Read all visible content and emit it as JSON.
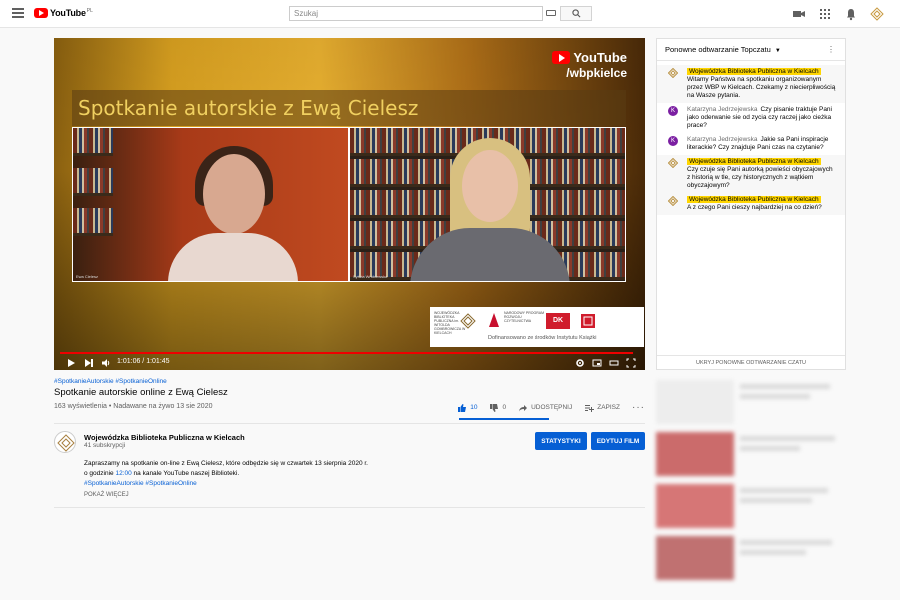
{
  "header": {
    "logo_text": "YouTube",
    "logo_region": "PL",
    "search_placeholder": "Szukaj"
  },
  "player": {
    "overlay_title": "Spotkanie autorskie z Ewą Cielesz",
    "brand_word": "YouTube",
    "brand_handle": "/wbpkielce",
    "cam_left_label": "Ewa Cielesz",
    "cam_right_label": "Sylwia Wróblewska",
    "sponsor_caption": "Dofinansowano ze środków Instytutu Książki",
    "sponsor_logo_1": "WOJEWÓDZKA BIBLIOTEKA PUBLICZNA im. WITOLDA GOMBROWICZA W KIELCACH",
    "sponsor_logo_2": "NARODOWY PROGRAM ROZWOJU CZYTELNICTWA",
    "sponsor_logo_3": "DK",
    "time_display": "1:01:06 / 1:01:45",
    "progress_fraction": 0.99
  },
  "video": {
    "hashtags": "#SpotkanieAutorskie #SpotkanieOnline",
    "title": "Spotkanie autorskie online z Ewą Cielesz",
    "stats": "163 wyświetlenia • Nadawane na żywo 13 sie 2020",
    "likes": "10",
    "dislikes": "0",
    "share_label": "UDOSTĘPNIJ",
    "save_label": "ZAPISZ"
  },
  "channel": {
    "name": "Wojewódzka Biblioteka Publiczna w Kielcach",
    "subs": "41 subskrypcji",
    "stats_button": "STATYSTYKI",
    "edit_button": "EDYTUJ FILM",
    "desc_line1": "Zapraszamy na spotkanie on-line z Ewą Cielesz, które odbędzie się w czwartek 13 sierpnia 2020 r.",
    "desc_line2_pre": "o godzinie ",
    "desc_line2_time": "12:00",
    "desc_line2_post": " na kanale YouTube naszej Biblioteki.",
    "desc_tags": "#SpotkanieAutorskie #SpotkanieOnline",
    "show_more": "POKAŻ WIĘCEJ"
  },
  "chat": {
    "title": "Ponowne odtwarzanie Topczatu",
    "hide_label": "UKRYJ PONOWNE ODTWARZANIE CZATU",
    "messages": [
      {
        "author": "Wojewódzka Biblioteka Publiczna w Kielcach",
        "text": "Witamy Państwa na spotkaniu organizowanym przez WBP w Kielcach. Czekamy z niecierpliwością na Wasze pytania."
      },
      {
        "author": "Katarzyna Jedrzejewska",
        "text": "Czy pisanie traktuje Pani jako oderwanie sie od zycia czy raczej jako cieżka prace?"
      },
      {
        "author": "Katarzyna Jedrzejewska",
        "text": "Jakie sa Pani inspiracje literackie? Czy znajduje Pani czas na czytanie?"
      },
      {
        "author": "Wojewódzka Biblioteka Publiczna w Kielcach",
        "text": "Czy czuje się Pani autorką powieści obyczajowych z historią w tle, czy historycznych z wątkiem obyczajowym?"
      },
      {
        "author": "Wojewódzka Biblioteka Publiczna w Kielcach",
        "text": "A z czego Pani cieszy najbardziej na co dzień?"
      }
    ],
    "avatar_letter": "K"
  },
  "colors": {
    "accent": "#065fd4",
    "brand_red": "#ff0000",
    "owner_badge": "#ffd600",
    "avatar_purple": "#7b1fa2"
  }
}
